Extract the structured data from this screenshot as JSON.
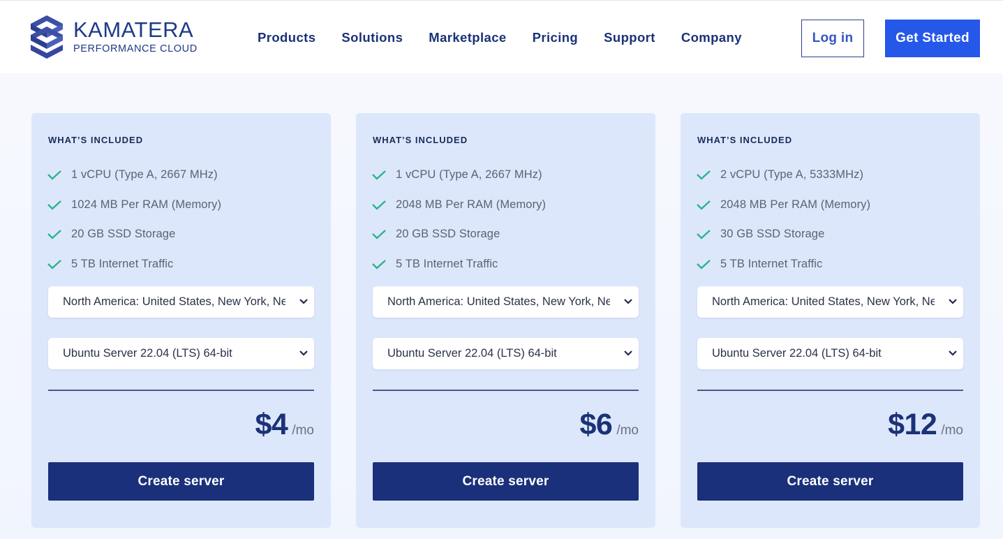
{
  "header": {
    "logo_name": "KAMATERA",
    "logo_tagline": "PERFORMANCE CLOUD",
    "nav": [
      "Products",
      "Solutions",
      "Marketplace",
      "Pricing",
      "Support",
      "Company"
    ],
    "login_label": "Log in",
    "get_started_label": "Get Started"
  },
  "colors": {
    "brand_navy": "#1b3276",
    "accent_blue": "#2557e9",
    "card_bg": "#dde7fc",
    "check_green": "#2bb38a",
    "button_navy": "#1a307a"
  },
  "plans": [
    {
      "included_title": "WHAT’S INCLUDED",
      "features": [
        "1 vCPU (Type A, 2667 MHz)",
        "1024 MB Per RAM (Memory)",
        "20 GB SSD Storage",
        "5 TB Internet Traffic"
      ],
      "location": "North America: United States, New York, New York",
      "os": "Ubuntu Server 22.04 (LTS) 64-bit",
      "price": "$4",
      "period": "/mo",
      "cta": "Create server"
    },
    {
      "included_title": "WHAT’S INCLUDED",
      "features": [
        "1 vCPU (Type A, 2667 MHz)",
        "2048 MB Per RAM (Memory)",
        "20 GB SSD Storage",
        "5 TB Internet Traffic"
      ],
      "location": "North America: United States, New York, New York",
      "os": "Ubuntu Server 22.04 (LTS) 64-bit",
      "price": "$6",
      "period": "/mo",
      "cta": "Create server"
    },
    {
      "included_title": "WHAT’S INCLUDED",
      "features": [
        "2 vCPU (Type A, 5333MHz)",
        "2048 MB Per RAM (Memory)",
        "30 GB SSD Storage",
        "5 TB Internet Traffic"
      ],
      "location": "North America: United States, New York, New York",
      "os": "Ubuntu Server 22.04 (LTS) 64-bit",
      "price": "$12",
      "period": "/mo",
      "cta": "Create server"
    }
  ]
}
